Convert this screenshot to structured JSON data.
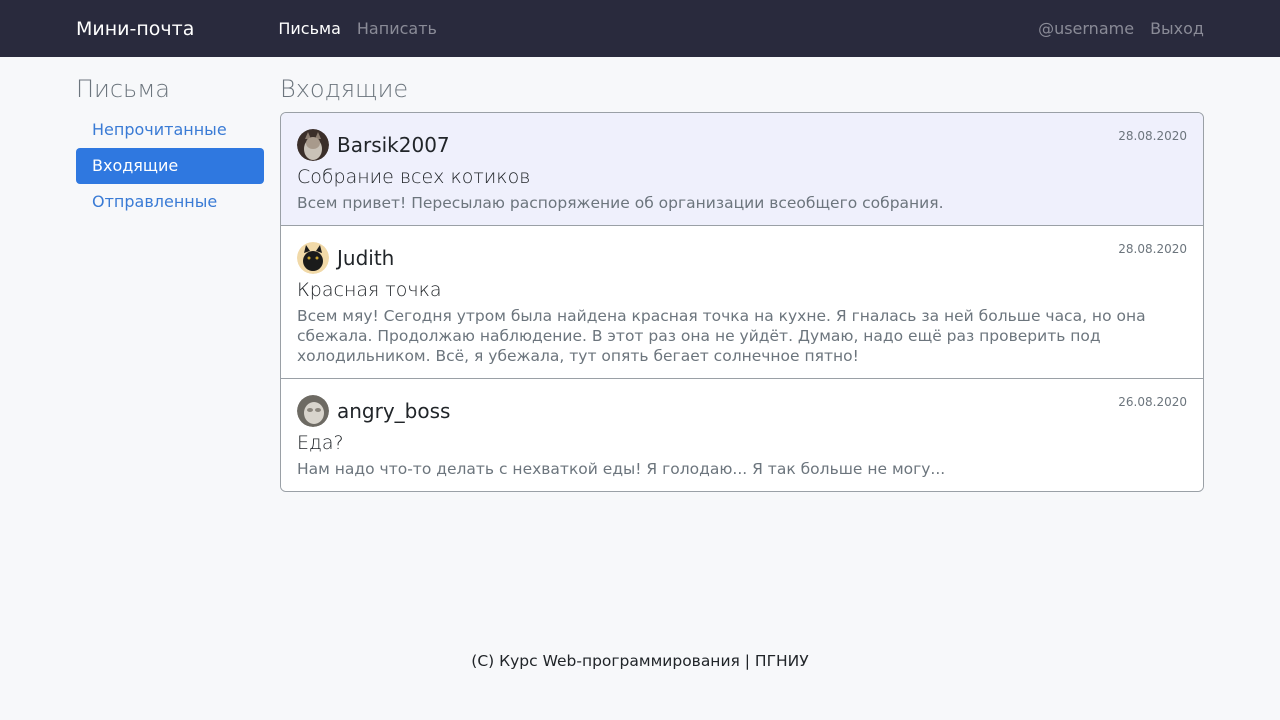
{
  "navbar": {
    "brand": "Мини-почта",
    "links": [
      {
        "label": "Письма",
        "active": true
      },
      {
        "label": "Написать",
        "active": false
      }
    ],
    "username": "@username",
    "logout": "Выход"
  },
  "sidebar": {
    "title": "Письма",
    "items": [
      {
        "label": "Непрочитанные",
        "active": false
      },
      {
        "label": "Входящие",
        "active": true
      },
      {
        "label": "Отправленные",
        "active": false
      }
    ]
  },
  "main": {
    "title": "Входящие",
    "messages": [
      {
        "sender": "Barsik2007",
        "date": "28.08.2020",
        "subject": "Собрание всех котиков",
        "preview": "Всем привет! Пересылаю распоряжение об организации всеобщего собрания.",
        "unread": true
      },
      {
        "sender": "Judith",
        "date": "28.08.2020",
        "subject": "Красная точка",
        "preview": "Всем мяу! Сегодня утром была найдена красная точка на кухне. Я гналась за ней больше часа, но она сбежала. Продолжаю наблюдение. В этот раз она не уйдёт. Думаю, надо ещё раз проверить под холодильником. Всё, я убежала, тут опять бегает солнечное пятно!",
        "unread": false
      },
      {
        "sender": "angry_boss",
        "date": "26.08.2020",
        "subject": "Еда?",
        "preview": "Нам надо что-то делать с нехваткой еды! Я голодаю... Я так больше не могу...",
        "unread": false
      }
    ]
  },
  "footer": "(C) Курс Web-программирования | ПГНИУ"
}
